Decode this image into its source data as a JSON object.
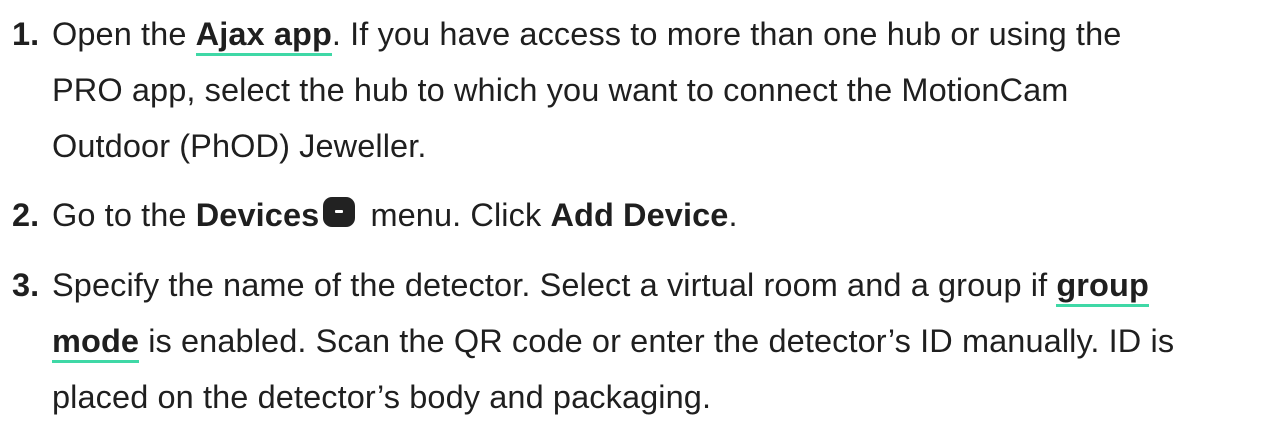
{
  "steps": [
    {
      "number": "1.",
      "line1_pre": "Open the ",
      "link": "Ajax app",
      "line1_post": ". If you have access to more than one hub or using the",
      "line2": "PRO app, select the hub to which you want to connect the MotionCam",
      "line3": "Outdoor (PhOD) Jeweller."
    },
    {
      "number": "2.",
      "pre": "Go to the ",
      "bold1": "Devices",
      "icon": "devices-icon",
      "mid": " menu. Click ",
      "bold2": "Add Device",
      "post": "."
    },
    {
      "number": "3.",
      "line1_pre": "Specify the name of the detector. Select a virtual room and a group if ",
      "link_part1": "group",
      "link_part2": "mode",
      "line2_post": " is enabled. Scan the QR code or enter the detector’s ID manually. ID is",
      "line3": "placed on the detector’s body and packaging."
    }
  ],
  "colors": {
    "text": "#1f1f1f",
    "link_underline": "#3fd8a6",
    "icon_bg": "#222222"
  }
}
